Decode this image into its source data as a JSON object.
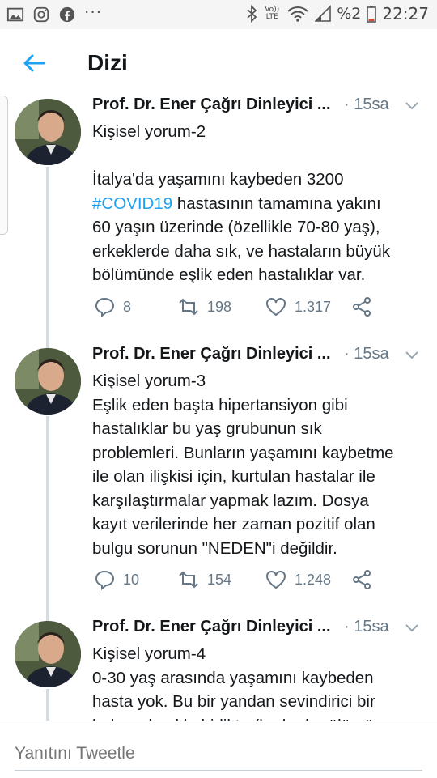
{
  "status_bar": {
    "icons_left": [
      "image-icon",
      "instagram-icon",
      "facebook-icon",
      "more-dots-icon"
    ],
    "icons_right": [
      "bluetooth-icon",
      "volte-icon",
      "wifi-icon",
      "signal-icon"
    ],
    "volte_label": "Vo)) LTE",
    "battery_text": "%2",
    "clock": "22:27"
  },
  "app_bar": {
    "title": "Dizi"
  },
  "tweets": [
    {
      "author": "Prof. Dr. Ener Çağrı Dinleyici",
      "ellipsis": "...",
      "time": "· 15sa",
      "lines": [
        "Kişisel yorum-2",
        "",
        "İtalya'da yaşamını kaybeden 3200",
        "hastasının tamamına yakını",
        "60 yaşın üzerinde (özellikle 70-80 yaş),",
        "erkeklerde daha sık, ve hastaların büyük",
        "bölümünde eşlik eden hastalıklar var."
      ],
      "hashtag": "#COVID19",
      "replies": "8",
      "retweets": "198",
      "likes": "1.317"
    },
    {
      "author": "Prof. Dr. Ener Çağrı Dinleyici",
      "ellipsis": "...",
      "time": "· 15sa",
      "lines": [
        "Kişisel yorum-3",
        "Eşlik eden başta hipertansiyon gibi",
        "hastalıklar bu yaş grubunun sık",
        "problemleri. Bunların yaşamını kaybetme",
        "ile olan ilişkisi için, kurtulan hastalar ile",
        "karşılaştırmalar yapmak lazım. Dosya",
        "kayıt verilerinde her zaman pozitif olan",
        "bulgu sorunun \"NEDEN\"i değildir."
      ],
      "replies": "10",
      "retweets": "154",
      "likes": "1.248"
    },
    {
      "author": "Prof. Dr. Ener Çağrı Dinleyici",
      "ellipsis": "...",
      "time": "· 15sa",
      "lines": [
        "Kişisel yorum-4",
        "0-30 yaş arasında yaşamını kaybeden",
        "hasta yok. Bu bir yandan sevindirici bir",
        "haber olmakla birlikte (bu kadar ölümün"
      ]
    }
  ],
  "reply_bar": {
    "placeholder": "Yanıtını Tweetle"
  },
  "colors": {
    "accent": "#1da1f2",
    "text": "#14171a",
    "muted": "#657786"
  }
}
